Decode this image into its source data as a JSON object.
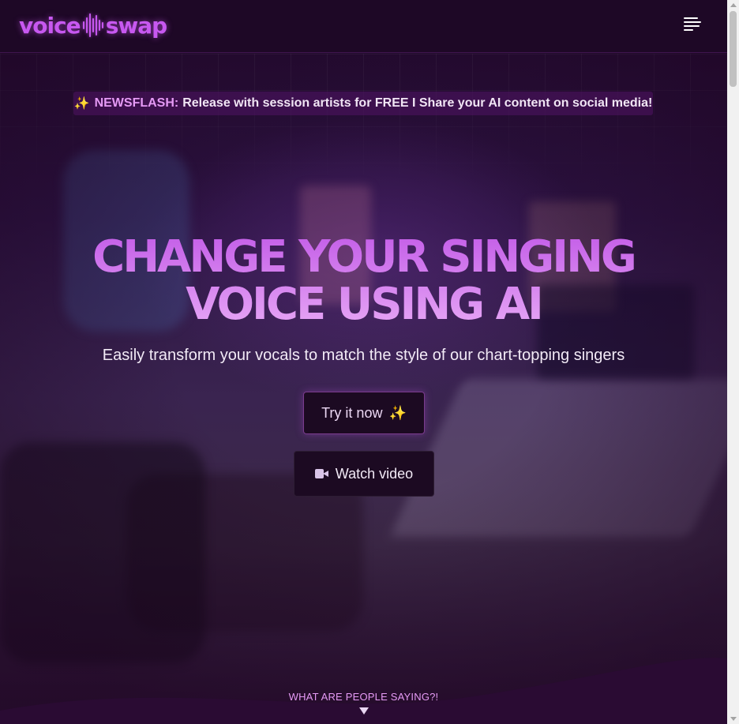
{
  "header": {
    "logo_left": "voice",
    "logo_right": "swap",
    "menu_icon": "hamburger-menu-icon"
  },
  "newsflash": {
    "icon": "sparkles-icon",
    "emoji": "✨",
    "tag": "NEWSFLASH:",
    "message": "Release with session artists for FREE I Share your AI content on social media!"
  },
  "hero": {
    "title_line1": "CHANGE YOUR SINGING",
    "title_line2": "VOICE USING AI",
    "subtitle": "Easily transform your vocals to match the style of our chart-topping singers",
    "try_label": "Try it now",
    "try_icon": "sparkles-icon",
    "try_emoji": "✨",
    "watch_label": "Watch video",
    "watch_icon": "video-camera-icon"
  },
  "footer_prompt": {
    "label": "WHAT ARE PEOPLE SAYING?!",
    "icon": "triangle-down-icon"
  },
  "colors": {
    "accent": "#c758f0",
    "accent_light": "#e59af5",
    "background": "#1a0720"
  }
}
